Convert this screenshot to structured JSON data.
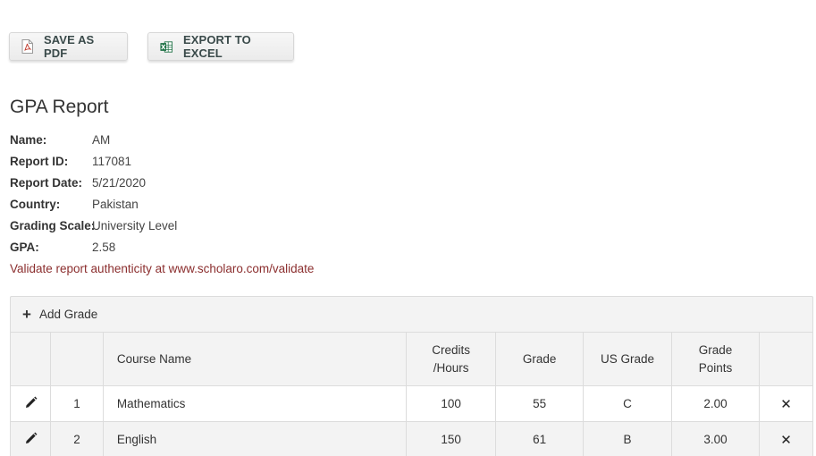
{
  "toolbar": {
    "save_pdf_label": "SAVE AS PDF",
    "export_excel_label": "EXPORT TO EXCEL",
    "pdf_icon": "pdf-file-icon",
    "excel_icon": "excel-file-icon",
    "excel_color": "#1e7145",
    "pdf_color": "#c0392b"
  },
  "report": {
    "title": "GPA Report",
    "fields": [
      {
        "label": "Name:",
        "value": "AM"
      },
      {
        "label": "Report ID:",
        "value": "117081"
      },
      {
        "label": "Report Date:",
        "value": "5/21/2020"
      },
      {
        "label": "Country:",
        "value": "Pakistan"
      },
      {
        "label": "Grading Scale:",
        "value": "University Level"
      },
      {
        "label": "GPA:",
        "value": "2.58"
      }
    ],
    "validate_text": "Validate report authenticity at www.scholaro.com/validate",
    "validate_color": "#8b2e2e"
  },
  "grades": {
    "add_label": "Add Grade",
    "columns": {
      "course": "Course Name",
      "credits_line1": "Credits",
      "credits_line2": "/Hours",
      "grade": "Grade",
      "us_grade": "US Grade",
      "points_line1": "Grade",
      "points_line2": "Points"
    },
    "rows": [
      {
        "num": "1",
        "course": "Mathematics",
        "credits": "100",
        "grade": "55",
        "us_grade": "C",
        "points": "2.00"
      },
      {
        "num": "2",
        "course": "English",
        "credits": "150",
        "grade": "61",
        "us_grade": "B",
        "points": "3.00"
      }
    ],
    "edit_icon": "pencil-icon",
    "delete_icon": "close-icon",
    "delete_glyph": "✕"
  }
}
